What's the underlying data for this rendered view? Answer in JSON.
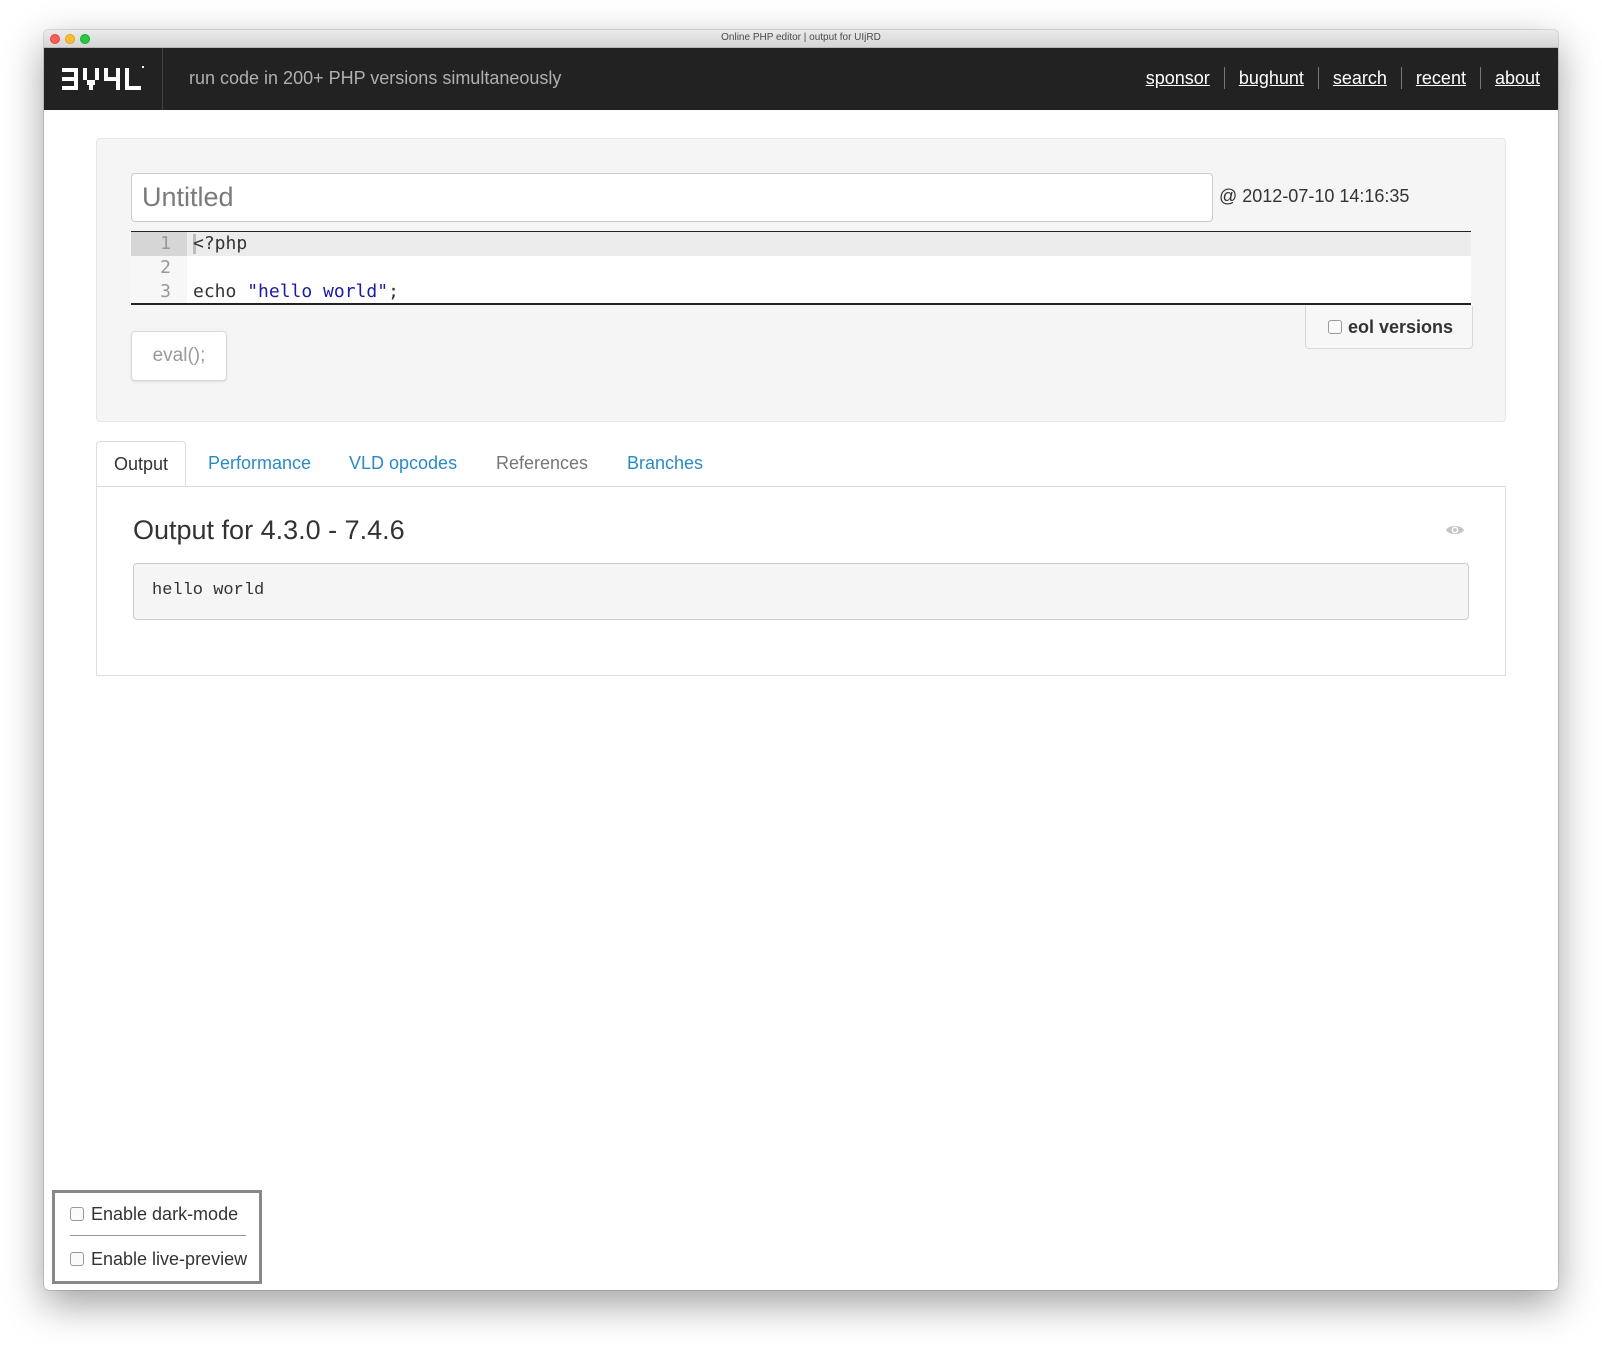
{
  "window": {
    "title": "Online PHP editor | output for UIjRD"
  },
  "navbar": {
    "logo_text": "3V4L",
    "tagline": "run code in 200+ PHP versions simultaneously",
    "links": [
      "sponsor",
      "bughunt",
      "search",
      "recent",
      "about"
    ]
  },
  "editor": {
    "title_placeholder": "Untitled",
    "timestamp": "@ 2012-07-10 14:16:35",
    "lines": [
      {
        "num": "1",
        "code": "<?php"
      },
      {
        "num": "2",
        "code": ""
      },
      {
        "num": "3",
        "code_prefix": "echo ",
        "code_string": "\"hello world\"",
        "code_suffix": ";"
      }
    ],
    "eval_label": "eval();",
    "eol_label": "eol versions"
  },
  "tabs": [
    {
      "label": "Output",
      "active": true
    },
    {
      "label": "Performance"
    },
    {
      "label": "VLD opcodes"
    },
    {
      "label": "References",
      "disabled": true
    },
    {
      "label": "Branches"
    }
  ],
  "output": {
    "heading": "Output for 4.3.0 - 7.4.6",
    "text": "hello world"
  },
  "settings": {
    "dark_mode_label": "Enable dark-mode",
    "live_preview_label": "Enable live-preview"
  },
  "colors": {
    "navbar_bg": "#222222",
    "link_blue": "#2a8bc4",
    "string_color": "#1a1aa6"
  }
}
